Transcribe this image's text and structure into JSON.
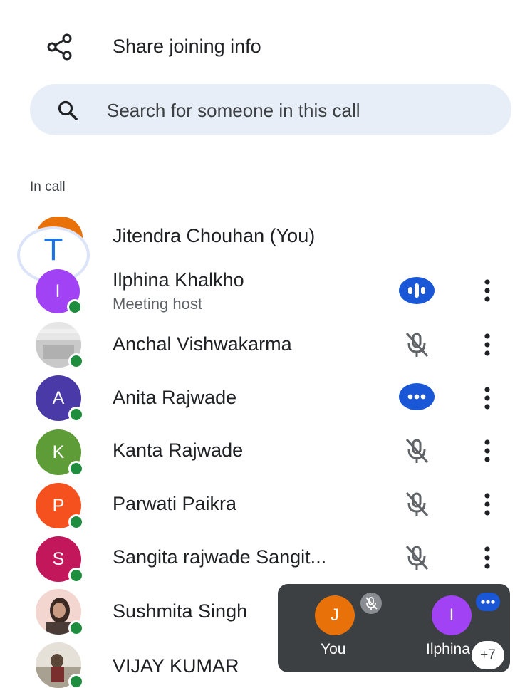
{
  "share": {
    "label": "Share joining info",
    "icon": "share-icon"
  },
  "search": {
    "placeholder": "Search for someone in this call",
    "value": "",
    "icon": "search-icon"
  },
  "section": {
    "label": "In call"
  },
  "self_avatar_letter": "T",
  "colors": {
    "accent": "#1a73e8",
    "speaking": "#1a57d6",
    "presence": "#1e8e3e",
    "self_avatar_top": "#e8710a"
  },
  "participants": [
    {
      "name": "Jitendra Chouhan (You)",
      "avatar": "",
      "color": "#e8710a",
      "status": "none"
    },
    {
      "name": "Ilphina Khalkho",
      "subtitle": "Meeting host",
      "avatar": "I",
      "color": "#a142f4",
      "status": "speaking"
    },
    {
      "name": "Anchal Vishwakarma",
      "avatar": "",
      "avatar_type": "photo",
      "status": "muted"
    },
    {
      "name": "Anita Rajwade",
      "avatar": "A",
      "color": "#4a3aa8",
      "status": "more"
    },
    {
      "name": "Kanta Rajwade",
      "avatar": "K",
      "color": "#5e9c37",
      "status": "muted"
    },
    {
      "name": "Parwati Paikra",
      "avatar": "P",
      "color": "#f4511e",
      "status": "muted"
    },
    {
      "name": "Sangita rajwade Sangit...",
      "avatar": "S",
      "color": "#c2185b",
      "status": "muted"
    },
    {
      "name": "Sushmita Singh",
      "avatar": "",
      "avatar_type": "photo",
      "status": "none"
    },
    {
      "name": "VIJAY KUMAR",
      "avatar": "",
      "avatar_type": "photo",
      "status": "none"
    }
  ],
  "mini_panel": {
    "tiles": [
      {
        "label": "You",
        "avatar": "J",
        "color": "#e8710a",
        "badge": "muted"
      },
      {
        "label": "Ilphina",
        "avatar": "I",
        "color": "#a142f4",
        "badge": "speaking"
      }
    ],
    "more_count": "+7"
  }
}
